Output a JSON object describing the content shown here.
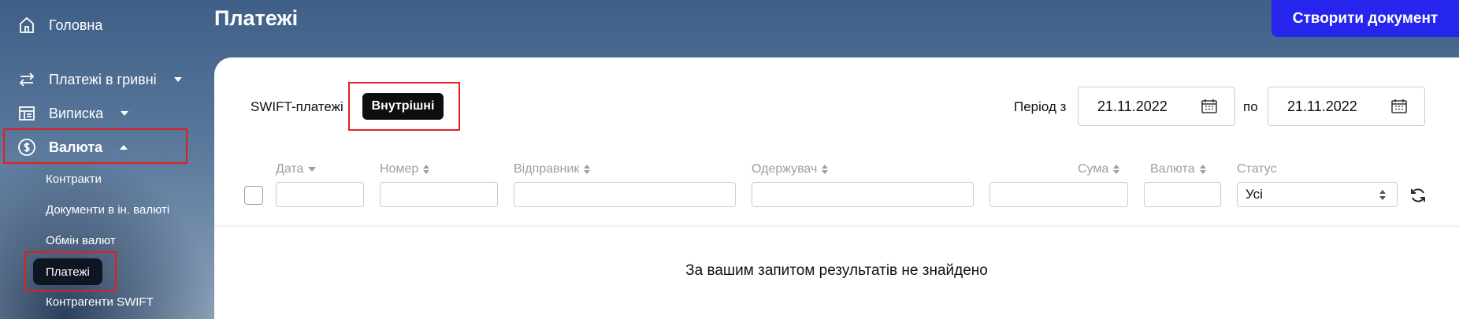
{
  "sidebar": {
    "home": "Головна",
    "payments_uah": "Платежі в гривні",
    "statement": "Виписка",
    "currency": "Валюта",
    "sub_items": {
      "contracts": "Контракти",
      "fx_documents": "Документи в ін. валюті",
      "exchange": "Обмін валют",
      "payments": "Платежі",
      "swift_contractors": "Контрагенти SWIFT"
    }
  },
  "header": {
    "title": "Платежі",
    "create_button": "Створити документ"
  },
  "tabs": {
    "swift": "SWIFT-платежі",
    "internal": "Внутрішні"
  },
  "period": {
    "from_label": "Період з",
    "from_value": "21.11.2022",
    "to_label": "по",
    "to_value": "21.11.2022"
  },
  "columns": {
    "date": "Дата",
    "number": "Номер",
    "sender": "Відправник",
    "recipient": "Одержувач",
    "amount": "Сума",
    "currency": "Валюта",
    "status": "Статус"
  },
  "filters": {
    "status_value": "Усі"
  },
  "empty_message": "За вашим запитом результатів не знайдено",
  "colors": {
    "accent": "#2525ee",
    "highlight_border": "#e02020",
    "active_tab_bg": "#0e0e0e"
  }
}
